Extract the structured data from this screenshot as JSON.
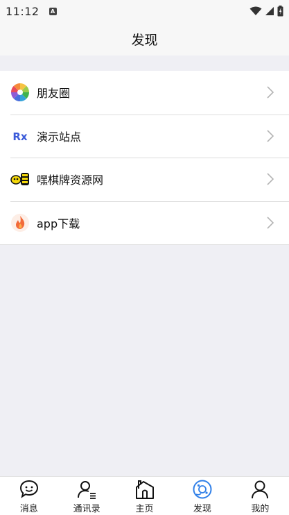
{
  "status_bar": {
    "time": "11:12",
    "badge": "A"
  },
  "nav": {
    "title": "发现"
  },
  "list": [
    {
      "label": "朋友圈",
      "icon": "pinwheel-icon"
    },
    {
      "label": "演示站点",
      "icon": "rx-logo-icon"
    },
    {
      "label": "嘿棋牌资源网",
      "icon": "qipai-logo-icon"
    },
    {
      "label": "app下载",
      "icon": "flame-icon"
    }
  ],
  "tabs": [
    {
      "label": "消息",
      "icon": "chat-bubble-icon",
      "active": false
    },
    {
      "label": "通讯录",
      "icon": "contacts-icon",
      "active": false
    },
    {
      "label": "主页",
      "icon": "home-icon",
      "active": false
    },
    {
      "label": "发现",
      "icon": "compass-icon",
      "active": true
    },
    {
      "label": "我的",
      "icon": "person-icon",
      "active": false
    }
  ],
  "colors": {
    "accent": "#2f7fe8",
    "background": "#efeff4"
  }
}
